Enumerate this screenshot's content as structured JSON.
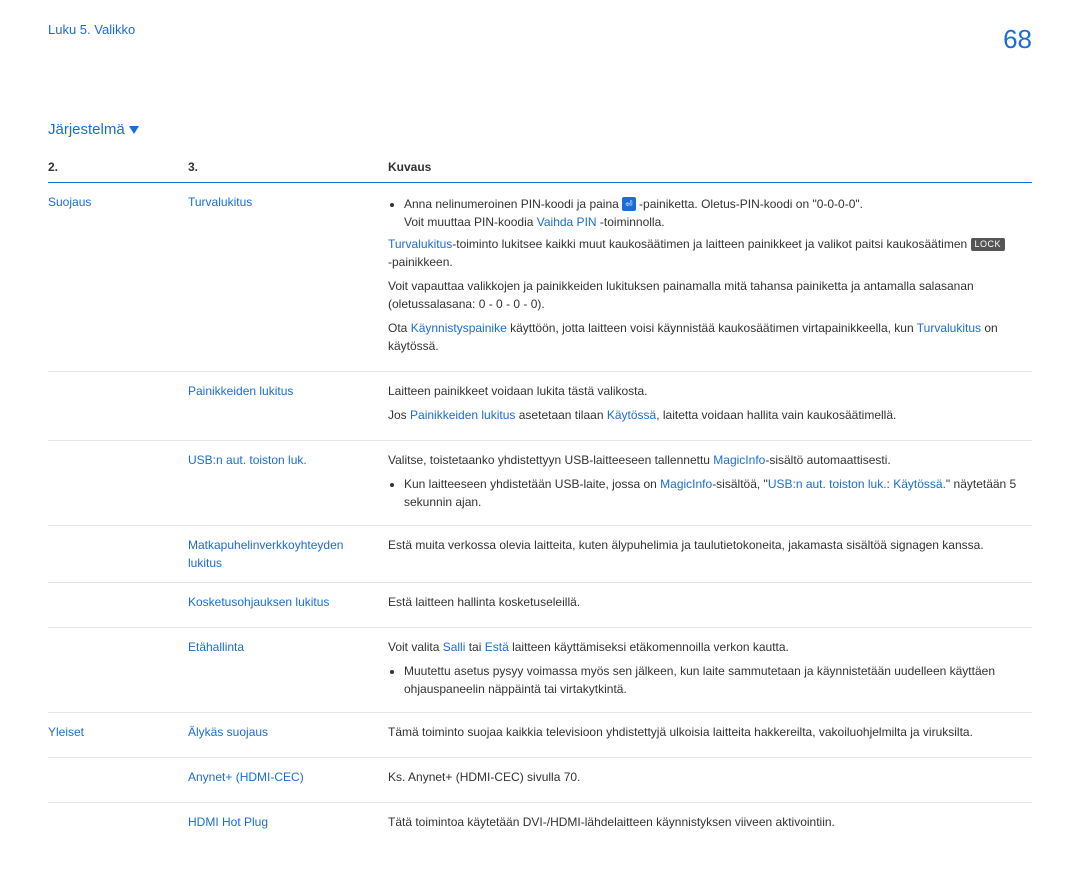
{
  "header": {
    "breadcrumb": "Luku 5. Valikko",
    "page_number": "68"
  },
  "section": {
    "title": "Järjestelmä"
  },
  "table": {
    "headers": {
      "c1": "2.",
      "c2": "3.",
      "c3": "Kuvaus"
    },
    "rows": [
      {
        "cat": "Suojaus",
        "sub": "Turvalukitus",
        "desc": {
          "b1_pre": "Anna nelinumeroinen PIN-koodi ja paina ",
          "b1_post": "-painiketta. Oletus-PIN-koodi on \"0-0-0-0\".",
          "l1a": "Voit muuttaa PIN-koodia ",
          "l1link": "Vaihda PIN",
          "l1b": " -toiminnolla.",
          "p2link": "Turvalukitus",
          "p2a": "-toiminto lukitsee kaikki muut kaukosäätimen ja laitteen painikkeet ja valikot paitsi kaukosäätimen ",
          "p2lock": "LOCK",
          "p2b": "-painikkeen.",
          "p3": "Voit vapauttaa valikkojen ja painikkeiden lukituksen painamalla mitä tahansa painiketta ja antamalla salasanan (oletussalasana: 0 - 0 - 0 - 0).",
          "p4a": "Ota ",
          "p4link1": "Käynnistyspainike",
          "p4b": " käyttöön, jotta laitteen voisi käynnistää kaukosäätimen virtapainikkeella, kun ",
          "p4link2": "Turvalukitus",
          "p4c": " on käytössä."
        }
      },
      {
        "cat": "",
        "sub": "Painikkeiden lukitus",
        "desc": {
          "p1": "Laitteen painikkeet voidaan lukita tästä valikosta.",
          "p2a": "Jos ",
          "p2link1": "Painikkeiden lukitus",
          "p2b": " asetetaan tilaan ",
          "p2link2": "Käytössä",
          "p2c": ", laitetta voidaan hallita vain kaukosäätimellä."
        }
      },
      {
        "cat": "",
        "sub": "USB:n aut. toiston luk.",
        "desc": {
          "p1a": "Valitse, toistetaanko yhdistettyyn USB-laitteeseen tallennettu ",
          "p1link": "MagicInfo",
          "p1b": "-sisältö automaattisesti.",
          "b1a": "Kun laitteeseen yhdistetään USB-laite, jossa on ",
          "b1link1": "MagicInfo",
          "b1b": "-sisältöä, \"",
          "b1link2": "USB:n aut. toiston luk.",
          "b1c": ": ",
          "b1link3": "Käytössä.",
          "b1d": "\" näytetään 5 sekunnin ajan."
        }
      },
      {
        "cat": "",
        "sub": "Matkapuhelinverkkoyhteyden lukitus",
        "desc": {
          "p1": "Estä muita verkossa olevia laitteita, kuten älypuhelimia ja taulutietokoneita, jakamasta sisältöä signagen kanssa."
        }
      },
      {
        "cat": "",
        "sub": "Kosketusohjauksen lukitus",
        "desc": {
          "p1": "Estä laitteen hallinta kosketuseleillä."
        }
      },
      {
        "cat": "",
        "sub": "Etähallinta",
        "desc": {
          "p1a": "Voit valita ",
          "p1link1": "Salli",
          "p1b": " tai ",
          "p1link2": "Estä",
          "p1c": " laitteen käyttämiseksi etäkomennoilla verkon kautta.",
          "b1": "Muutettu asetus pysyy voimassa myös sen jälkeen, kun laite sammutetaan ja käynnistetään uudelleen käyttäen ohjauspaneelin näppäintä tai virtakytkintä."
        }
      },
      {
        "cat": "Yleiset",
        "sub": "Älykäs suojaus",
        "desc": {
          "p1": "Tämä toiminto suojaa kaikkia televisioon yhdistettyjä ulkoisia laitteita hakkereilta, vakoiluohjelmilta ja viruksilta."
        }
      },
      {
        "cat": "",
        "sub": "Anynet+ (HDMI-CEC)",
        "desc": {
          "p1": "Ks. Anynet+ (HDMI-CEC) sivulla 70."
        }
      },
      {
        "cat": "",
        "sub": "HDMI Hot Plug",
        "desc": {
          "p1": "Tätä toimintoa käytetään DVI-/HDMI-lähdelaitteen käynnistyksen viiveen aktivointiin."
        }
      }
    ]
  }
}
